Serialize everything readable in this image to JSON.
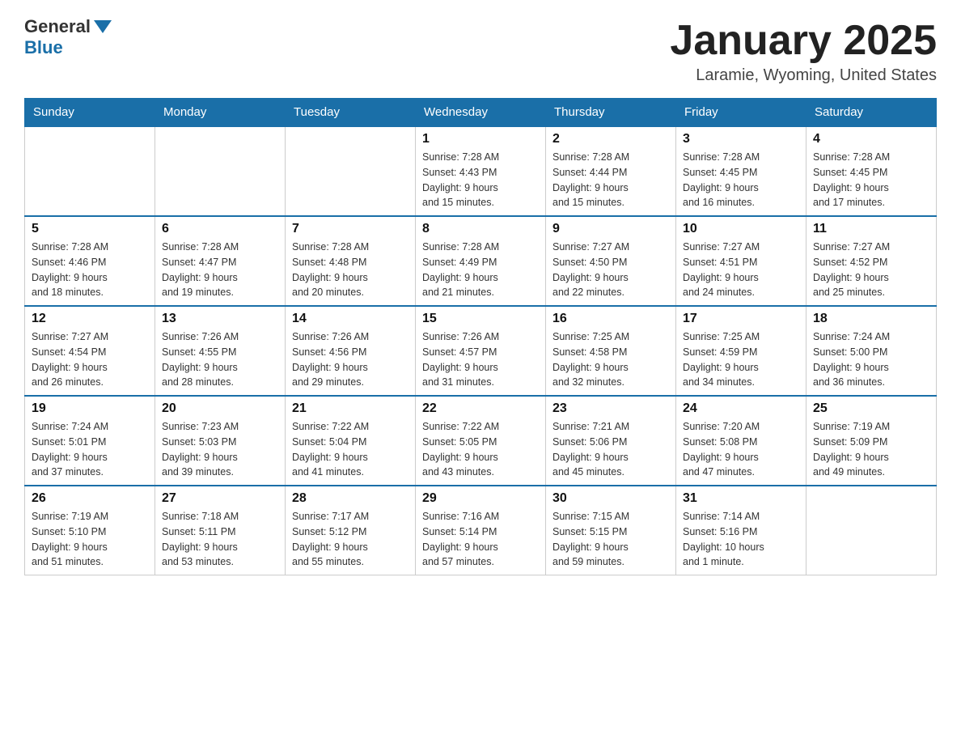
{
  "header": {
    "logo_general": "General",
    "logo_blue": "Blue",
    "month": "January 2025",
    "location": "Laramie, Wyoming, United States"
  },
  "days_of_week": [
    "Sunday",
    "Monday",
    "Tuesday",
    "Wednesday",
    "Thursday",
    "Friday",
    "Saturday"
  ],
  "weeks": [
    [
      {
        "day": "",
        "info": ""
      },
      {
        "day": "",
        "info": ""
      },
      {
        "day": "",
        "info": ""
      },
      {
        "day": "1",
        "info": "Sunrise: 7:28 AM\nSunset: 4:43 PM\nDaylight: 9 hours\nand 15 minutes."
      },
      {
        "day": "2",
        "info": "Sunrise: 7:28 AM\nSunset: 4:44 PM\nDaylight: 9 hours\nand 15 minutes."
      },
      {
        "day": "3",
        "info": "Sunrise: 7:28 AM\nSunset: 4:45 PM\nDaylight: 9 hours\nand 16 minutes."
      },
      {
        "day": "4",
        "info": "Sunrise: 7:28 AM\nSunset: 4:45 PM\nDaylight: 9 hours\nand 17 minutes."
      }
    ],
    [
      {
        "day": "5",
        "info": "Sunrise: 7:28 AM\nSunset: 4:46 PM\nDaylight: 9 hours\nand 18 minutes."
      },
      {
        "day": "6",
        "info": "Sunrise: 7:28 AM\nSunset: 4:47 PM\nDaylight: 9 hours\nand 19 minutes."
      },
      {
        "day": "7",
        "info": "Sunrise: 7:28 AM\nSunset: 4:48 PM\nDaylight: 9 hours\nand 20 minutes."
      },
      {
        "day": "8",
        "info": "Sunrise: 7:28 AM\nSunset: 4:49 PM\nDaylight: 9 hours\nand 21 minutes."
      },
      {
        "day": "9",
        "info": "Sunrise: 7:27 AM\nSunset: 4:50 PM\nDaylight: 9 hours\nand 22 minutes."
      },
      {
        "day": "10",
        "info": "Sunrise: 7:27 AM\nSunset: 4:51 PM\nDaylight: 9 hours\nand 24 minutes."
      },
      {
        "day": "11",
        "info": "Sunrise: 7:27 AM\nSunset: 4:52 PM\nDaylight: 9 hours\nand 25 minutes."
      }
    ],
    [
      {
        "day": "12",
        "info": "Sunrise: 7:27 AM\nSunset: 4:54 PM\nDaylight: 9 hours\nand 26 minutes."
      },
      {
        "day": "13",
        "info": "Sunrise: 7:26 AM\nSunset: 4:55 PM\nDaylight: 9 hours\nand 28 minutes."
      },
      {
        "day": "14",
        "info": "Sunrise: 7:26 AM\nSunset: 4:56 PM\nDaylight: 9 hours\nand 29 minutes."
      },
      {
        "day": "15",
        "info": "Sunrise: 7:26 AM\nSunset: 4:57 PM\nDaylight: 9 hours\nand 31 minutes."
      },
      {
        "day": "16",
        "info": "Sunrise: 7:25 AM\nSunset: 4:58 PM\nDaylight: 9 hours\nand 32 minutes."
      },
      {
        "day": "17",
        "info": "Sunrise: 7:25 AM\nSunset: 4:59 PM\nDaylight: 9 hours\nand 34 minutes."
      },
      {
        "day": "18",
        "info": "Sunrise: 7:24 AM\nSunset: 5:00 PM\nDaylight: 9 hours\nand 36 minutes."
      }
    ],
    [
      {
        "day": "19",
        "info": "Sunrise: 7:24 AM\nSunset: 5:01 PM\nDaylight: 9 hours\nand 37 minutes."
      },
      {
        "day": "20",
        "info": "Sunrise: 7:23 AM\nSunset: 5:03 PM\nDaylight: 9 hours\nand 39 minutes."
      },
      {
        "day": "21",
        "info": "Sunrise: 7:22 AM\nSunset: 5:04 PM\nDaylight: 9 hours\nand 41 minutes."
      },
      {
        "day": "22",
        "info": "Sunrise: 7:22 AM\nSunset: 5:05 PM\nDaylight: 9 hours\nand 43 minutes."
      },
      {
        "day": "23",
        "info": "Sunrise: 7:21 AM\nSunset: 5:06 PM\nDaylight: 9 hours\nand 45 minutes."
      },
      {
        "day": "24",
        "info": "Sunrise: 7:20 AM\nSunset: 5:08 PM\nDaylight: 9 hours\nand 47 minutes."
      },
      {
        "day": "25",
        "info": "Sunrise: 7:19 AM\nSunset: 5:09 PM\nDaylight: 9 hours\nand 49 minutes."
      }
    ],
    [
      {
        "day": "26",
        "info": "Sunrise: 7:19 AM\nSunset: 5:10 PM\nDaylight: 9 hours\nand 51 minutes."
      },
      {
        "day": "27",
        "info": "Sunrise: 7:18 AM\nSunset: 5:11 PM\nDaylight: 9 hours\nand 53 minutes."
      },
      {
        "day": "28",
        "info": "Sunrise: 7:17 AM\nSunset: 5:12 PM\nDaylight: 9 hours\nand 55 minutes."
      },
      {
        "day": "29",
        "info": "Sunrise: 7:16 AM\nSunset: 5:14 PM\nDaylight: 9 hours\nand 57 minutes."
      },
      {
        "day": "30",
        "info": "Sunrise: 7:15 AM\nSunset: 5:15 PM\nDaylight: 9 hours\nand 59 minutes."
      },
      {
        "day": "31",
        "info": "Sunrise: 7:14 AM\nSunset: 5:16 PM\nDaylight: 10 hours\nand 1 minute."
      },
      {
        "day": "",
        "info": ""
      }
    ]
  ]
}
